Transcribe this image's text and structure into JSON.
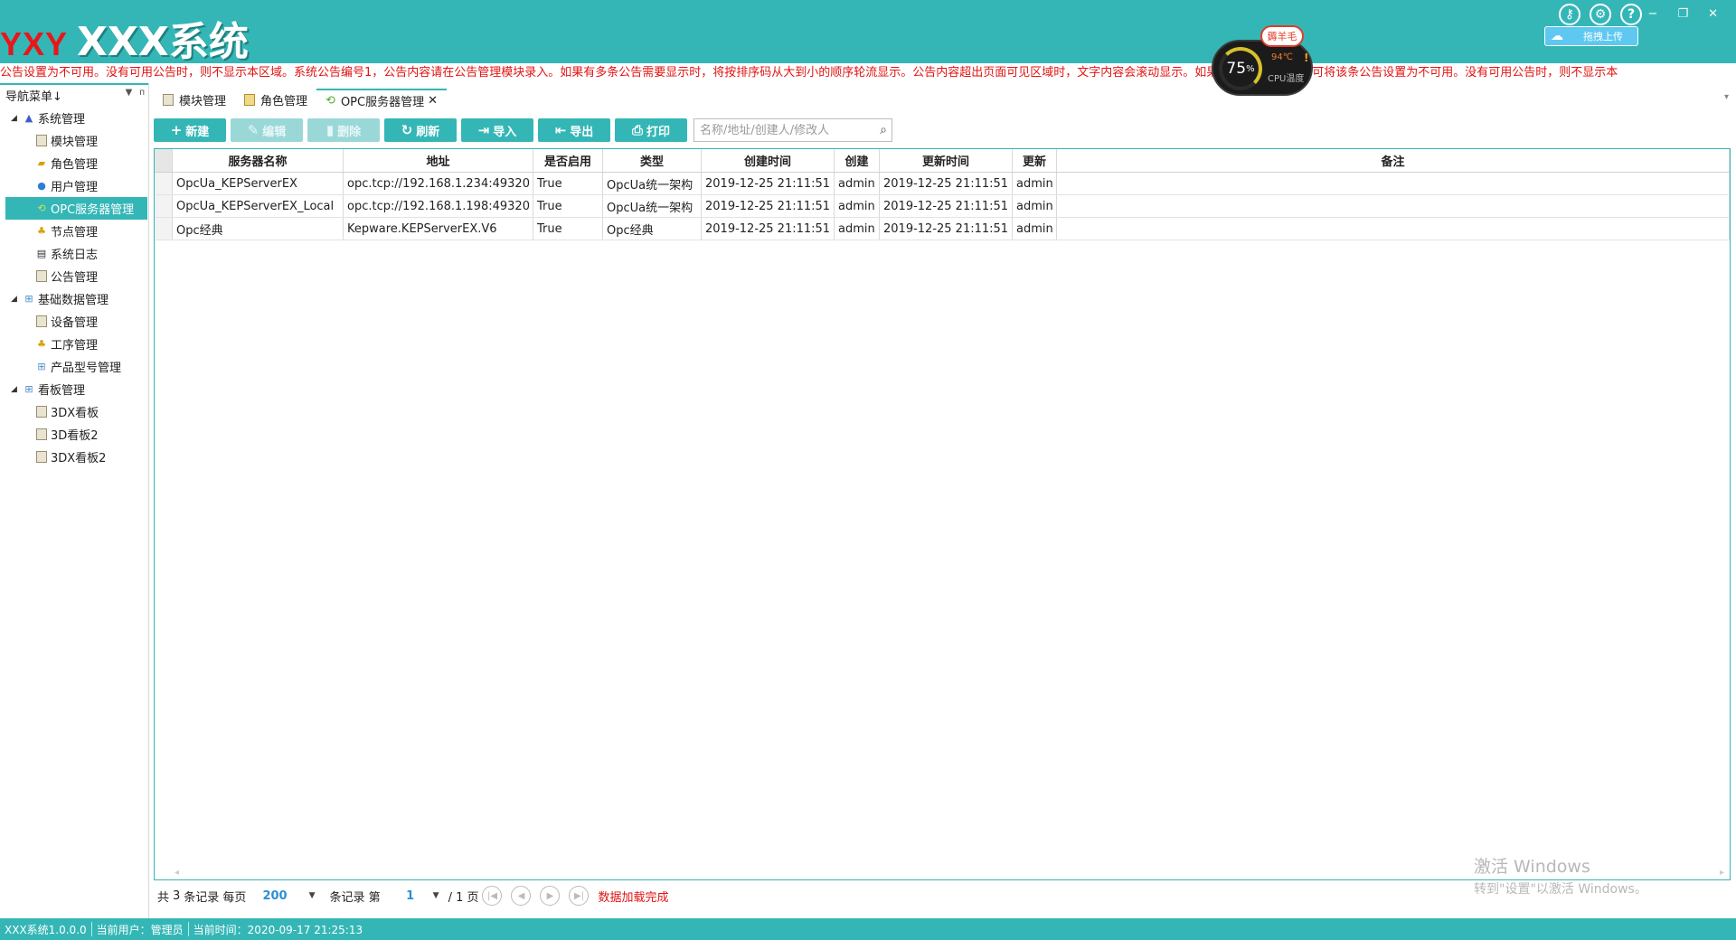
{
  "header": {
    "logo_red": "YXY",
    "logo_white": "XXX系统",
    "icons": [
      "key-icon",
      "gear-icon",
      "help-icon"
    ],
    "window_controls": [
      "minimize",
      "restore",
      "close"
    ],
    "minimize_glyph": "−",
    "restore_glyph": "❐",
    "close_glyph": "✕",
    "upload_label": "拖拽上传"
  },
  "cpu_widget": {
    "badge": "薅羊毛",
    "percent": "75",
    "percent_unit": "%",
    "temp": "94℃",
    "label": "CPU温度",
    "warn": "!"
  },
  "marquee": {
    "text": "公告设置为不可用。没有可用公告时，则不显示本区域。系统公告编号1，公告内容请在公告管理模块录入。如果有多条公告需要显示时，将按排序码从大到小的顺序轮流显示。公告内容超出页面可见区域时，文字内容会滚动显示。如果不显示某条公告，可将该条公告设置为不可用。没有可用公告时，则不显示本"
  },
  "sidebar": {
    "title": "导航菜单↓",
    "pin_glyph": "ᴨ",
    "items": [
      {
        "label": "系统管理",
        "level": 0,
        "icon": "system-group-icon"
      },
      {
        "label": "模块管理",
        "level": 1,
        "icon": "module-icon"
      },
      {
        "label": "角色管理",
        "level": 1,
        "icon": "role-icon"
      },
      {
        "label": "用户管理",
        "level": 1,
        "icon": "user-icon"
      },
      {
        "label": "OPC服务器管理",
        "level": 1,
        "icon": "opc-server-icon",
        "active": true
      },
      {
        "label": "节点管理",
        "level": 1,
        "icon": "node-icon"
      },
      {
        "label": "系统日志",
        "level": 1,
        "icon": "log-icon"
      },
      {
        "label": "公告管理",
        "level": 1,
        "icon": "notice-icon"
      },
      {
        "label": "基础数据管理",
        "level": 0,
        "icon": "basic-data-icon"
      },
      {
        "label": "设备管理",
        "level": 1,
        "icon": "device-icon"
      },
      {
        "label": "工序管理",
        "level": 1,
        "icon": "process-icon"
      },
      {
        "label": "产品型号管理",
        "level": 1,
        "icon": "product-model-icon"
      },
      {
        "label": "看板管理",
        "level": 0,
        "icon": "dashboard-group-icon"
      },
      {
        "label": "3DX看板",
        "level": 1,
        "icon": "board-icon"
      },
      {
        "label": "3D看板2",
        "level": 1,
        "icon": "board-icon"
      },
      {
        "label": "3DX看板2",
        "level": 1,
        "icon": "board-icon"
      }
    ]
  },
  "tabs": [
    {
      "label": "模块管理"
    },
    {
      "label": "角色管理"
    },
    {
      "label": "OPC服务器管理",
      "active": true,
      "closable": true
    }
  ],
  "toolbar": {
    "new": "新建",
    "edit": "编辑",
    "delete": "删除",
    "refresh": "刷新",
    "import": "导入",
    "export": "导出",
    "print": "打印",
    "search_placeholder": "名称/地址/创建人/修改人"
  },
  "grid": {
    "columns": [
      "服务器名称",
      "地址",
      "是否启用",
      "类型",
      "创建时间",
      "创建",
      "更新时间",
      "更新",
      "备注"
    ],
    "rows": [
      [
        "OpcUa_KEPServerEX",
        "opc.tcp://192.168.1.234:49320",
        "True",
        "OpcUa统一架构",
        "2019-12-25 21:11:51",
        "admin",
        "2019-12-25 21:11:51",
        "admin",
        ""
      ],
      [
        "OpcUa_KEPServerEX_Local",
        "opc.tcp://192.168.1.198:49320",
        "True",
        "OpcUa统一架构",
        "2019-12-25 21:11:51",
        "admin",
        "2019-12-25 21:11:51",
        "admin",
        ""
      ],
      [
        "Opc经典",
        "Kepware.KEPServerEX.V6",
        "True",
        "Opc经典",
        "2019-12-25 21:11:51",
        "admin",
        "2019-12-25 21:11:51",
        "admin",
        ""
      ]
    ]
  },
  "pager": {
    "total_prefix": "共",
    "total": "3",
    "total_suffix": "条记录 每页",
    "page_size": "200",
    "records_label": "条记录 第",
    "page": "1",
    "of_label": "/ 1 页",
    "status": "数据加载完成"
  },
  "watermark": {
    "line1": "激活 Windows",
    "line2": "转到\"设置\"以激活 Windows。"
  },
  "statusbar": {
    "version": "XXX系统1.0.0.0",
    "user": "当前用户：管理员",
    "time": "当前时间：2020-09-17 21:25:13"
  },
  "colors": {
    "primary": "#35b6b6",
    "alert_text": "#e21212",
    "logo_red": "#e8161a"
  }
}
